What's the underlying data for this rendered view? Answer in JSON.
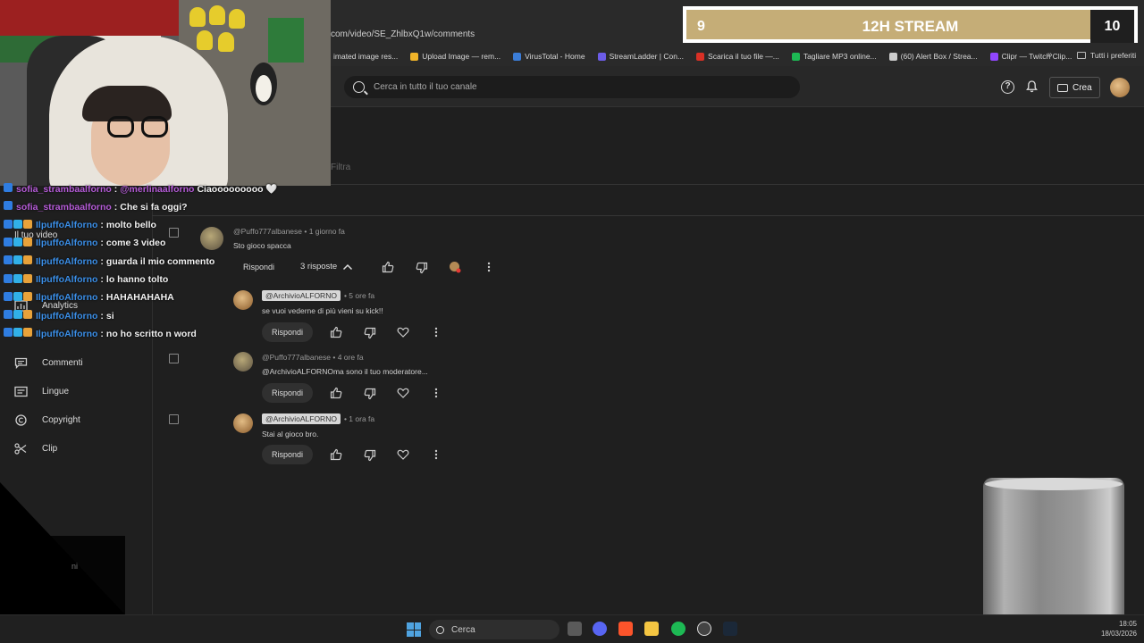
{
  "browser": {
    "url": "com/video/SE_ZhlbxQ1w/comments",
    "bookmarks": [
      {
        "label": "imated image res...",
        "color": "#888888"
      },
      {
        "label": "Upload Image — rem...",
        "color": "#f0b429"
      },
      {
        "label": "VirusTotal - Home",
        "color": "#3b7dd8"
      },
      {
        "label": "StreamLadder | Con...",
        "color": "#6c5ce7"
      },
      {
        "label": "Scarica il tuo file —...",
        "color": "#d93025"
      },
      {
        "label": "Tagliare MP3 online...",
        "color": "#1db954"
      },
      {
        "label": "(60) Alert Box / Strea...",
        "color": "#cccccc"
      },
      {
        "label": "Clipr — Twitch Clip...",
        "color": "#9146ff"
      }
    ],
    "more": "»",
    "folder": "Tutti i preferiti"
  },
  "header": {
    "search_placeholder": "Cerca in tutto il tuo canale",
    "create_label": "Crea",
    "help_glyph": "?"
  },
  "filter_label": "Filtra",
  "sidebar": {
    "items": [
      {
        "label": "Analytics",
        "icon": "analytics-icon"
      },
      {
        "label": "Commenti",
        "icon": "comments-icon"
      },
      {
        "label": "Lingue",
        "icon": "languages-icon"
      },
      {
        "label": "Copyright",
        "icon": "copyright-icon"
      },
      {
        "label": "Clip",
        "icon": "clip-icon"
      }
    ],
    "ghost_video_label": "Il tuo video",
    "ghost_bottom": "ni"
  },
  "comments": [
    {
      "author": "@Puffo777albanese",
      "time": "1 giorno fa",
      "text": "Sto gioco spacca",
      "reply": "Rispondi",
      "replies_label": "3 risposte"
    },
    {
      "author": "@ArchivioALFORNO",
      "time": "5 ore fa",
      "text": "se vuoi vederne di più vieni su kick!!",
      "reply": "Rispondi"
    },
    {
      "author": "@Puffo777albanese",
      "time": "4 ore fa",
      "text": "@ArchivioALFORNOma sono il tuo moderatore...",
      "reply": "Rispondi"
    },
    {
      "author": "@ArchivioALFORNO",
      "time": "1 ora fa",
      "text": "Stai al gioco bro.",
      "reply": "Rispondi"
    }
  ],
  "chat": [
    {
      "user": "sofia_strambaalforno",
      "mention": "@merlinaalforno",
      "msg": "Ciaooooooooo 🤍",
      "color": "purple"
    },
    {
      "user": "sofia_strambaalforno",
      "msg": "Che si fa oggi?",
      "color": "purple"
    },
    {
      "user": "IlpuffoAlforno",
      "msg": "molto bello",
      "color": "blue"
    },
    {
      "user": "IlpuffoAlforno",
      "msg": "come 3 video",
      "color": "blue"
    },
    {
      "user": "IlpuffoAlforno",
      "msg": "guarda il mio commento",
      "color": "blue"
    },
    {
      "user": "IlpuffoAlforno",
      "msg": "lo hanno tolto",
      "color": "blue"
    },
    {
      "user": "IlpuffoAlforno",
      "msg": "HAHAHAHAHA",
      "color": "blue"
    },
    {
      "user": "IlpuffoAlforno",
      "msg": "si",
      "color": "blue"
    },
    {
      "user": "IlpuffoAlforno",
      "msg": "no ho scritto n word",
      "color": "blue"
    }
  ],
  "counter": {
    "left": "9",
    "title": "12H STREAM",
    "right": "10"
  },
  "taskbar": {
    "search_label": "Cerca",
    "time": "18:05",
    "date": "18/03/2026"
  }
}
